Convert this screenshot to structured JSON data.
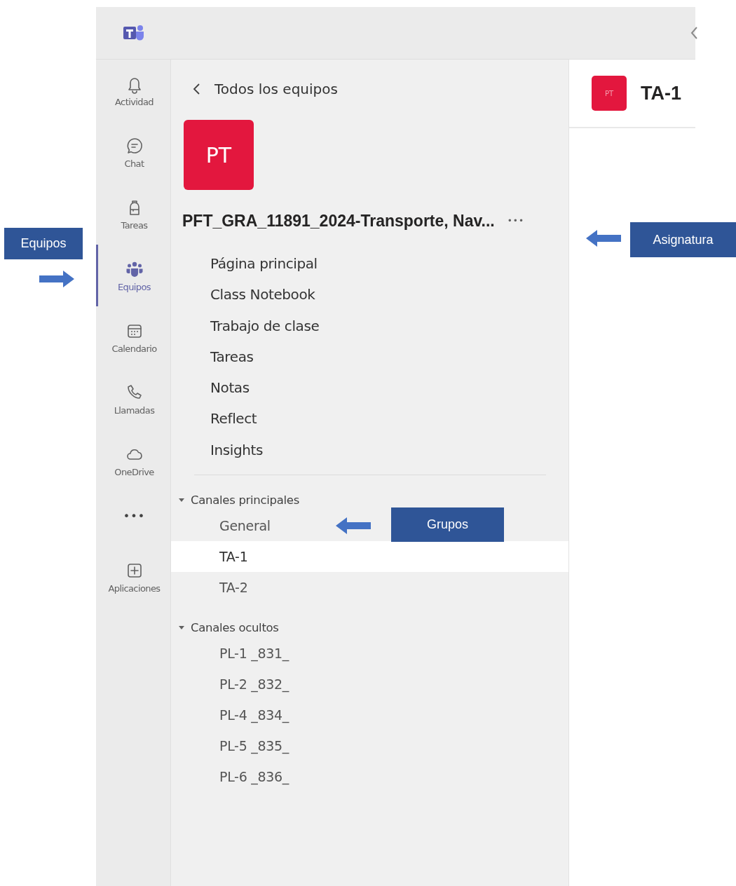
{
  "rail": {
    "items": [
      {
        "label": "Actividad",
        "kind": "bell",
        "selected": false
      },
      {
        "label": "Chat",
        "kind": "chat",
        "selected": false
      },
      {
        "label": "Tareas",
        "kind": "backpack",
        "selected": false
      },
      {
        "label": "Equipos",
        "kind": "teams",
        "selected": true
      },
      {
        "label": "Calendario",
        "kind": "calendar",
        "selected": false
      },
      {
        "label": "Llamadas",
        "kind": "phone",
        "selected": false
      },
      {
        "label": "OneDrive",
        "kind": "cloud",
        "selected": false
      },
      {
        "label": "•••",
        "kind": "more",
        "selected": false
      },
      {
        "label": "Aplicaciones",
        "kind": "add",
        "selected": false
      }
    ]
  },
  "team_panel": {
    "back_label": "Todos los equipos",
    "avatar": "PT",
    "name": "PFT_GRA_11891_2024-Transporte, Nav...",
    "more": "•••",
    "tabs": [
      "Página principal",
      "Class Notebook",
      "Trabajo de clase",
      "Tareas",
      "Notas",
      "Reflect",
      "Insights"
    ],
    "sections": [
      {
        "title": "Canales principales",
        "expanded": true,
        "channels": [
          {
            "name": "General",
            "selected": false
          },
          {
            "name": "TA-1",
            "selected": true
          },
          {
            "name": "TA-2",
            "selected": false
          }
        ]
      },
      {
        "title": "Canales ocultos",
        "expanded": true,
        "channels": [
          {
            "name": "PL-1 _831_",
            "selected": false
          },
          {
            "name": "PL-2 _832_",
            "selected": false
          },
          {
            "name": "PL-4 _834_",
            "selected": false
          },
          {
            "name": "PL-5 _835_",
            "selected": false
          },
          {
            "name": "PL-6 _836_",
            "selected": false
          }
        ]
      }
    ]
  },
  "channel_header": {
    "avatar": "PT",
    "title": "TA-1"
  },
  "annotations": [
    {
      "label": "Equipos",
      "points_left": false
    },
    {
      "label": "Asignatura",
      "points_left": true
    },
    {
      "label": "Grupos",
      "points_left": true
    }
  ]
}
